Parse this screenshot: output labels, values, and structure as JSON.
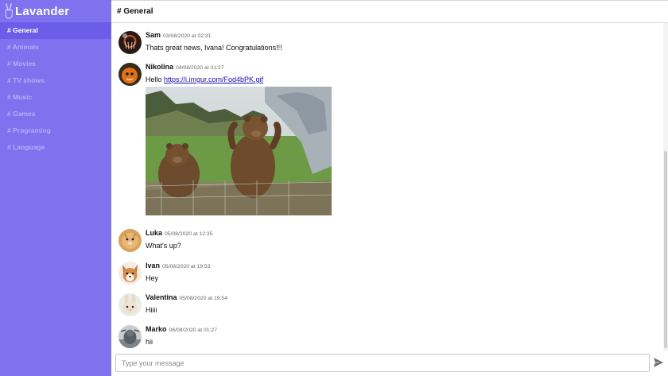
{
  "app": {
    "name": "Lavander",
    "brand_color": "#7e72ef",
    "active_color": "#6a5ee8",
    "logo_icon": "peace-hand-icon"
  },
  "sidebar": {
    "channels": [
      {
        "label": "# General",
        "active": true
      },
      {
        "label": "# Animals",
        "active": false
      },
      {
        "label": "# Movies",
        "active": false
      },
      {
        "label": "# TV shows",
        "active": false
      },
      {
        "label": "# Music",
        "active": false
      },
      {
        "label": "# Games",
        "active": false
      },
      {
        "label": "# Programing",
        "active": false
      },
      {
        "label": "# Language",
        "active": false
      }
    ]
  },
  "header": {
    "title": "# General"
  },
  "messages": [
    {
      "author": "Sam",
      "time": "03/08/2020 at 02:31",
      "text": "Thats great news, Ivana! Congratulations!!!"
    },
    {
      "author": "Nikolina",
      "time": "04/08/2020 at 01:27",
      "text_prefix": "Hello ",
      "link": "https://i.imgur.com/Fod4bPK.gif",
      "attachment": "bears-waving-gif"
    },
    {
      "author": "Luka",
      "time": "05/08/2020 at 12:35",
      "text": "What's up?"
    },
    {
      "author": "Ivan",
      "time": "05/08/2020 at 19:53",
      "text": "Hey"
    },
    {
      "author": "Valentina",
      "time": "05/08/2020 at 19:54",
      "text": "Hiiii"
    },
    {
      "author": "Marko",
      "time": "06/08/2020 at 01:27",
      "text": "hii"
    }
  ],
  "composer": {
    "placeholder": "Type your message",
    "send_icon": "send-icon"
  }
}
